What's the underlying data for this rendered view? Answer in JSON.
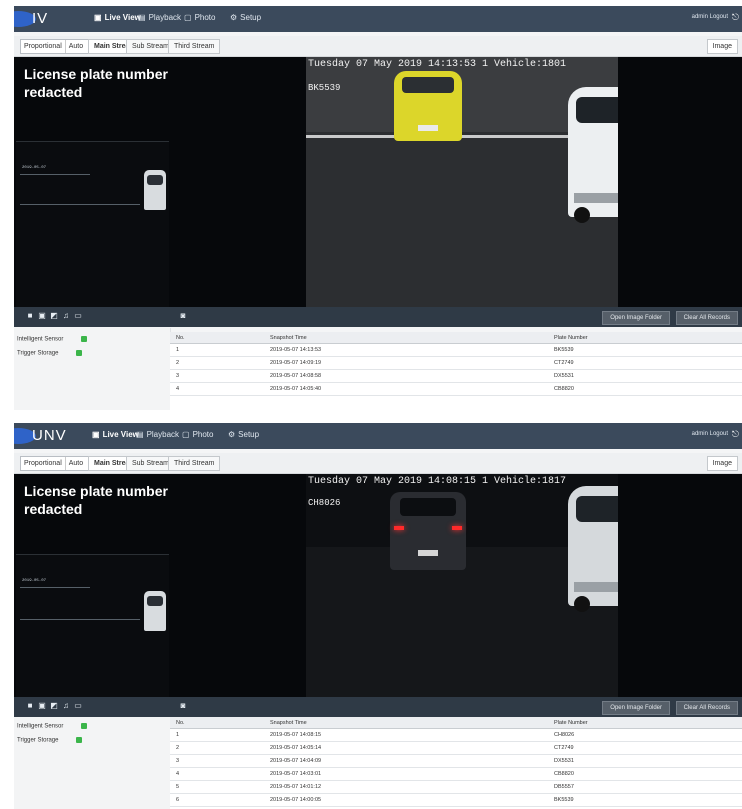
{
  "panels": [
    {
      "app": {
        "logo_text": "IV"
      },
      "nav": [
        {
          "icon": "▣",
          "label": "Live View",
          "active": true
        },
        {
          "icon": "▤",
          "label": "Playback",
          "active": false
        },
        {
          "icon": "▢",
          "label": "Photo",
          "active": false
        },
        {
          "icon": "⚙",
          "label": "Setup",
          "active": false
        }
      ],
      "user": "admin  Logout",
      "toolbar": {
        "select_label": "Proportional",
        "select_value": "Auto",
        "tabs": [
          "Main Stream",
          "Sub Stream",
          "Third Stream"
        ],
        "image_button": "Image"
      },
      "redaction": "License plate number\nredacted",
      "overlay": {
        "line1": "Tuesday 07 May 2019 14:13:53 1 Vehicle:1801",
        "line2": "BK5539"
      },
      "left_overlay": "2019-05-07",
      "buttons": [
        "Open Image Folder",
        "Clear All Records"
      ],
      "side": [
        "Intelligent Sensor",
        "Trigger Storage"
      ],
      "table": {
        "headers": [
          "No.",
          "Snapshot Time",
          "Plate Number"
        ],
        "rows": [
          [
            "1",
            "2019-05-07 14:13:53",
            "BK5539"
          ],
          [
            "2",
            "2019-05-07 14:09:19",
            "CT2749"
          ],
          [
            "3",
            "2019-05-07 14:08:58",
            "DX5531"
          ],
          [
            "4",
            "2019-05-07 14:05:40",
            "CB8820"
          ]
        ]
      }
    },
    {
      "app": {
        "logo_text": "UNV"
      },
      "nav": [
        {
          "icon": "▣",
          "label": "Live View",
          "active": true
        },
        {
          "icon": "▤",
          "label": "Playback",
          "active": false
        },
        {
          "icon": "▢",
          "label": "Photo",
          "active": false
        },
        {
          "icon": "⚙",
          "label": "Setup",
          "active": false
        }
      ],
      "user": "admin  Logout",
      "toolbar": {
        "select_label": "Proportional",
        "select_value": "Auto",
        "tabs": [
          "Main Stream",
          "Sub Stream",
          "Third Stream"
        ],
        "image_button": "Image"
      },
      "redaction": "License plate number\nredacted",
      "overlay": {
        "line1": "Tuesday 07 May 2019 14:08:15 1 Vehicle:1817",
        "line2": "CH8026"
      },
      "left_overlay": "2019-05-07",
      "buttons": [
        "Open Image Folder",
        "Clear All Records"
      ],
      "side": [
        "Intelligent Sensor",
        "Trigger Storage"
      ],
      "table": {
        "headers": [
          "No.",
          "Snapshot Time",
          "Plate Number"
        ],
        "rows": [
          [
            "1",
            "2019-05-07 14:08:15",
            "CH8026"
          ],
          [
            "2",
            "2019-05-07 14:05:14",
            "CT2749"
          ],
          [
            "3",
            "2019-05-07 14:04:09",
            "DX5531"
          ],
          [
            "4",
            "2019-05-07 14:03:01",
            "CB8820"
          ],
          [
            "5",
            "2019-05-07 14:01:12",
            "DB5557"
          ],
          [
            "6",
            "2019-05-07 14:00:05",
            "BK5539"
          ]
        ]
      }
    }
  ]
}
